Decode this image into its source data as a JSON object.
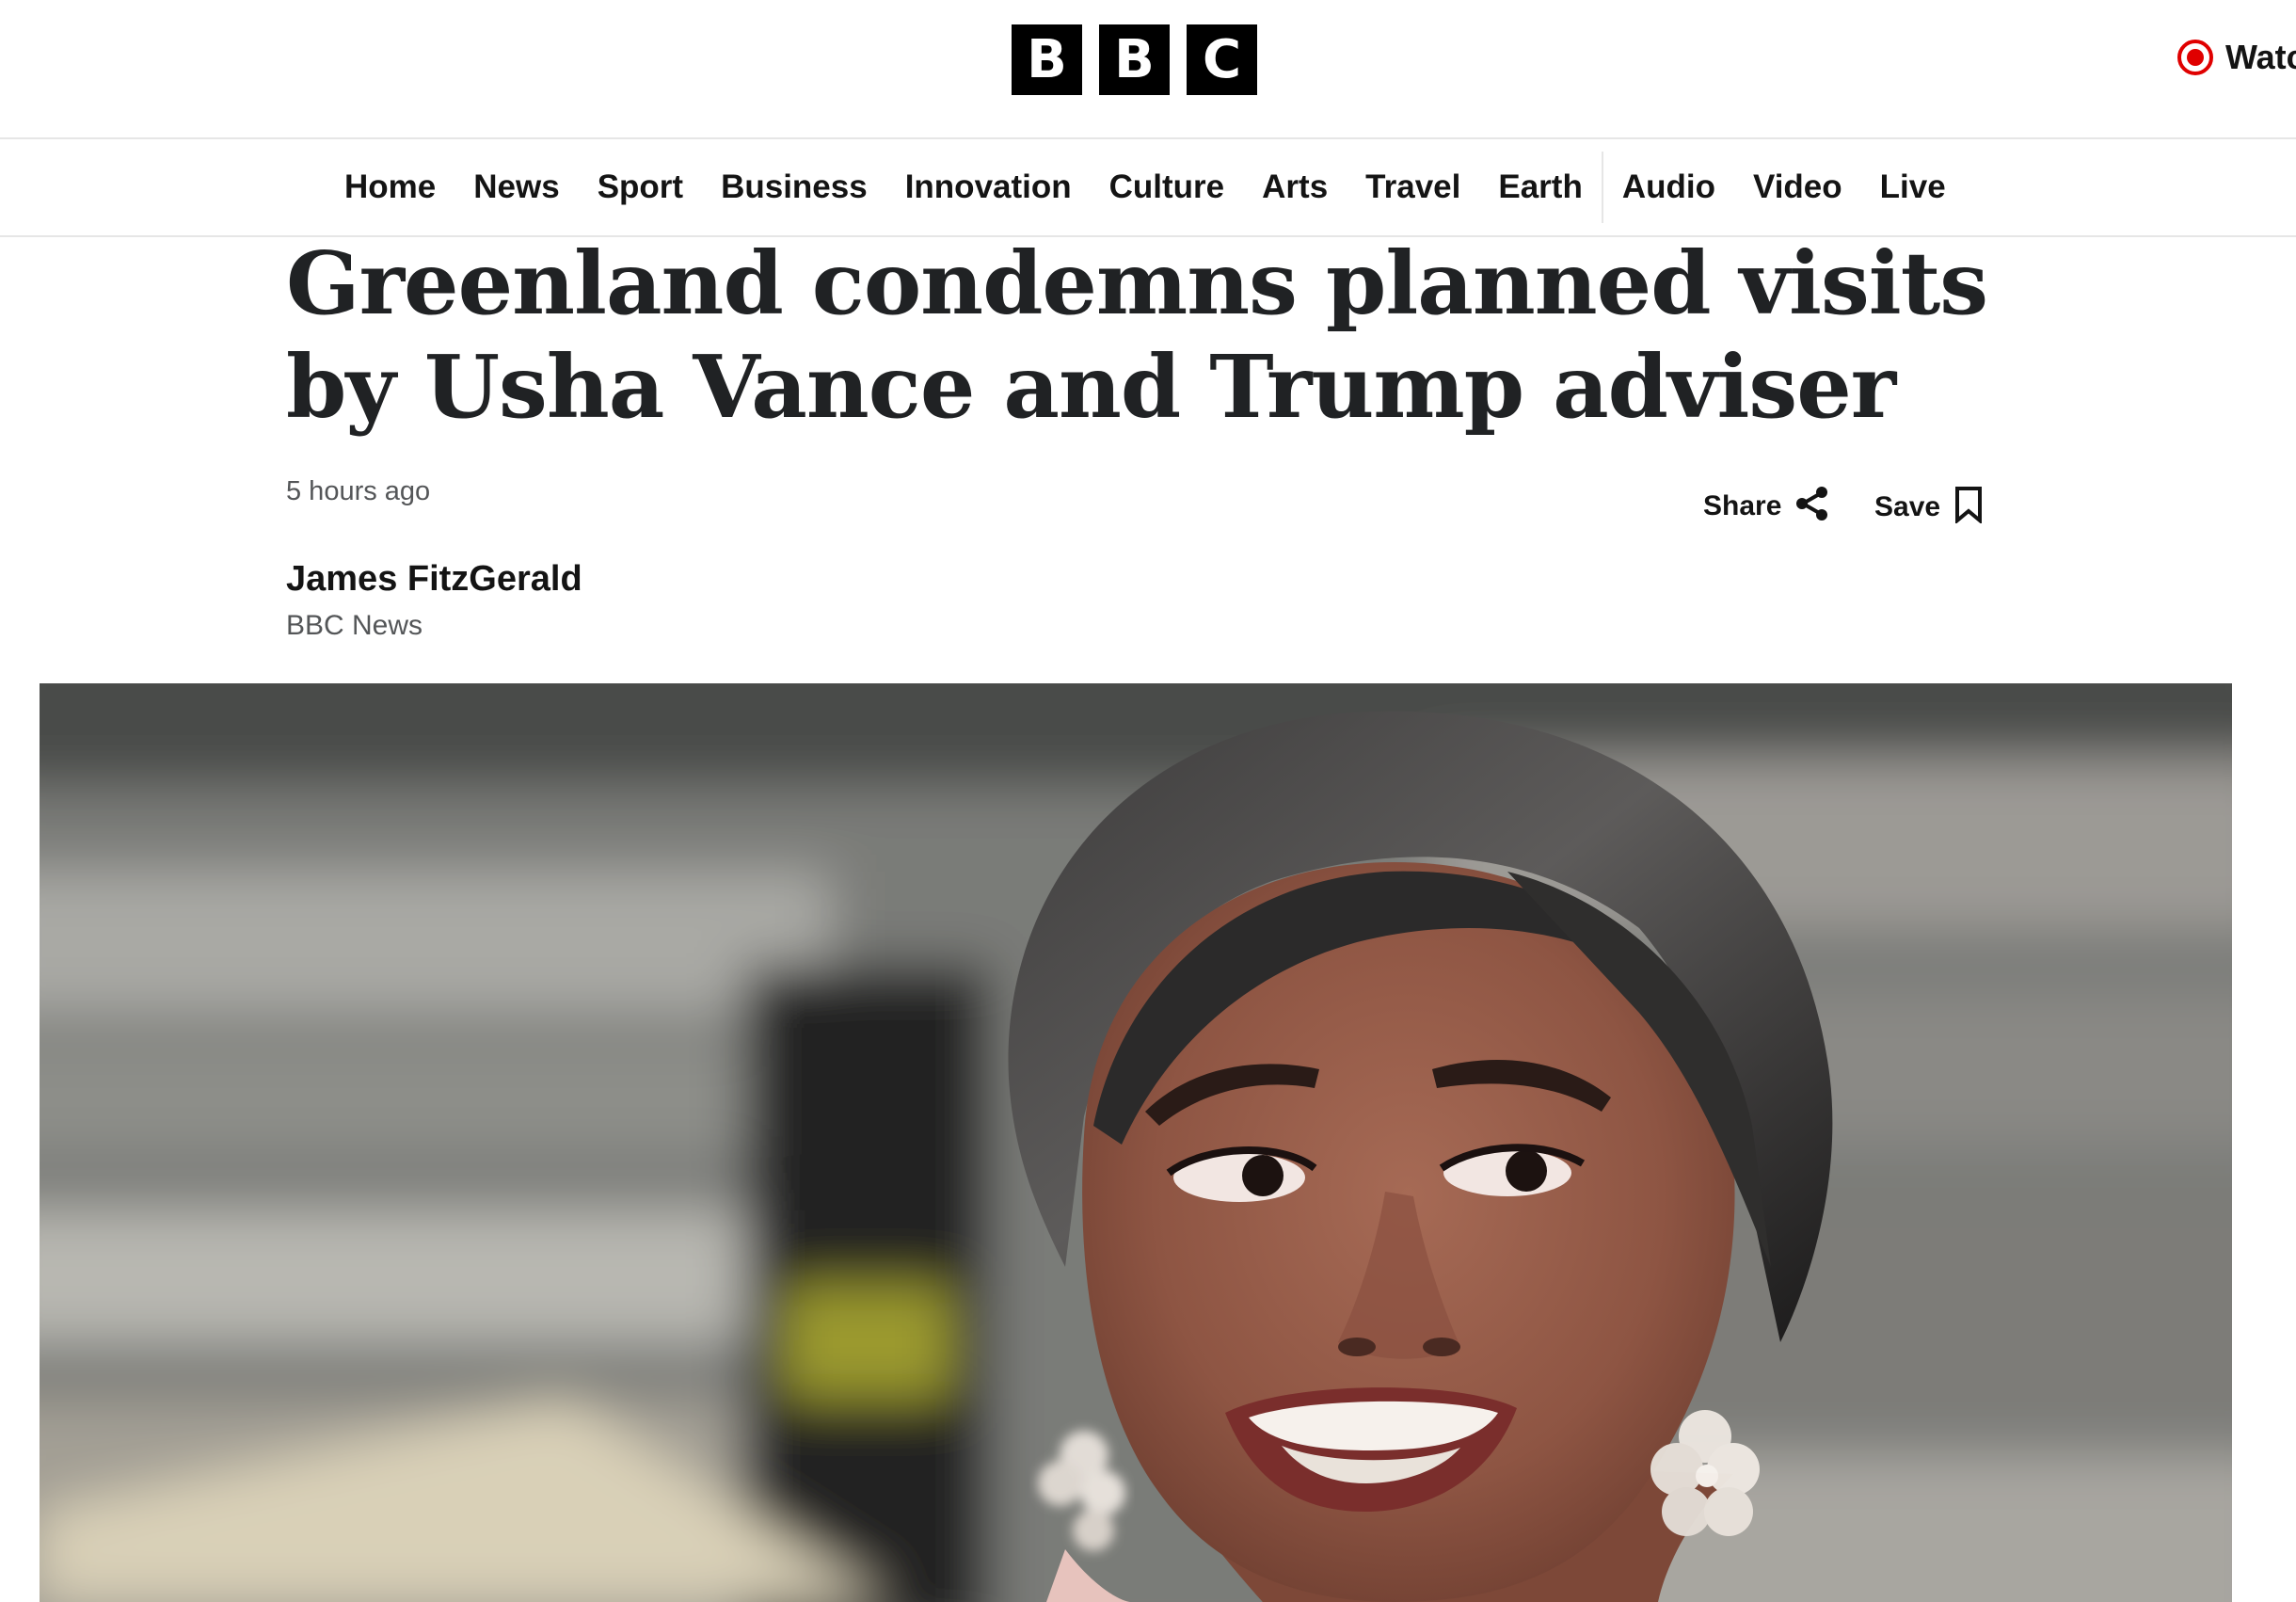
{
  "masthead": {
    "logo_letters": [
      "B",
      "B",
      "C"
    ],
    "watch_live_label": "Watch Live",
    "live_icon": "live-record-icon",
    "live_color": "#e00000"
  },
  "nav": {
    "items": [
      {
        "label": "Home"
      },
      {
        "label": "News"
      },
      {
        "label": "Sport"
      },
      {
        "label": "Business"
      },
      {
        "label": "Innovation"
      },
      {
        "label": "Culture"
      },
      {
        "label": "Arts"
      },
      {
        "label": "Travel"
      },
      {
        "label": "Earth"
      },
      {
        "label": "Audio"
      },
      {
        "label": "Video"
      },
      {
        "label": "Live"
      }
    ]
  },
  "article": {
    "headline": "Greenland condemns planned visits by Usha Vance and Trump adviser",
    "timestamp": "5 hours ago",
    "share_label": "Share",
    "share_icon": "share-icon",
    "save_label": "Save",
    "save_icon": "bookmark-icon",
    "author_name": "James FitzGerald",
    "author_org": "BBC News",
    "hero_image": "photo-of-smiling-woman"
  }
}
